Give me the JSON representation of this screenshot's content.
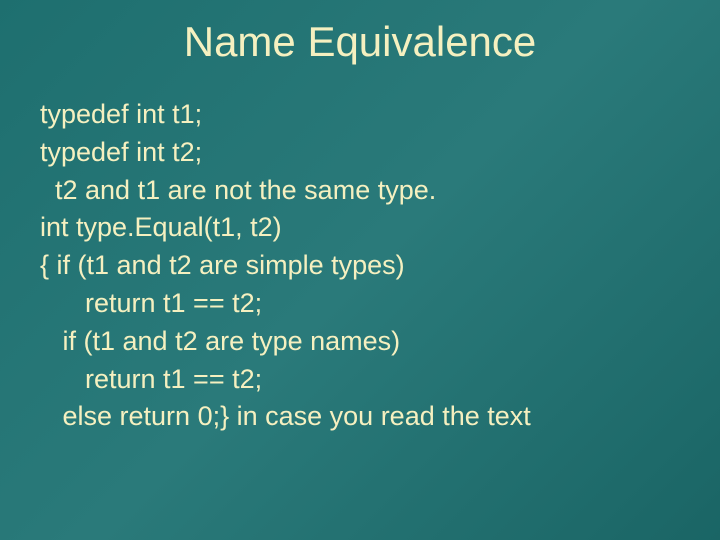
{
  "slide": {
    "title": "Name Equivalence",
    "lines": [
      "typedef int t1;",
      "typedef int t2;",
      "  t2 and t1 are not the same type.",
      "int type.Equal(t1, t2)",
      "{ if (t1 and t2 are simple types)",
      "      return t1 == t2;",
      "   if (t1 and t2 are type names)",
      "      return t1 == t2;",
      "   else return 0;} in case you read the text"
    ]
  }
}
